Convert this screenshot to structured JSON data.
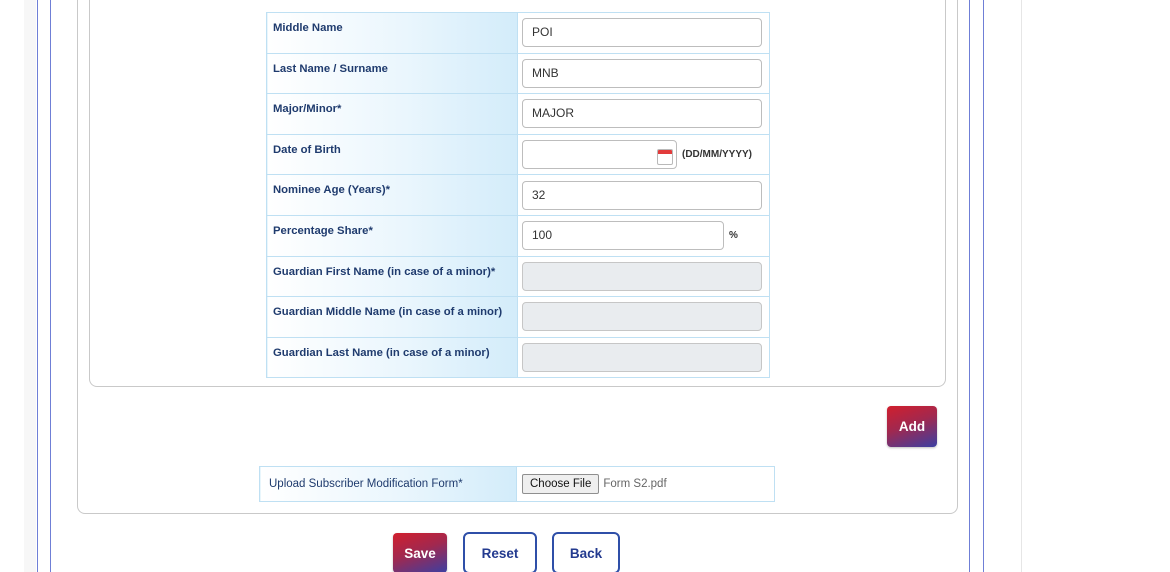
{
  "nominee_form": {
    "rows": [
      {
        "label": "Middle Name",
        "value": "POI"
      },
      {
        "label": "Last Name / Surname",
        "value": "MNB"
      },
      {
        "label": "Major/Minor*",
        "value": "MAJOR"
      },
      {
        "label": "Date of Birth",
        "value": "",
        "hint": "(DD/MM/YYYY)"
      },
      {
        "label": "Nominee Age (Years)*",
        "value": "32"
      },
      {
        "label": "Percentage Share*",
        "value": "100",
        "unit": "%"
      },
      {
        "label": "Guardian First Name (in case of a minor)*",
        "value": ""
      },
      {
        "label": "Guardian Middle Name (in case of a minor)",
        "value": ""
      },
      {
        "label": "Guardian Last Name (in case of a minor)",
        "value": ""
      }
    ]
  },
  "add_button": {
    "label": "Add"
  },
  "upload": {
    "label": "Upload Subscriber Modification Form*",
    "choose_label": "Choose File",
    "file_name": "Form S2.pdf"
  },
  "actions": {
    "save_label": "Save",
    "reset_label": "Reset",
    "back_label": "Back"
  },
  "colors": {
    "label_text": "#1f3b6e",
    "table_border": "#bfe0f3",
    "frame_blue": "#6f7fd6",
    "button_gradient_start": "#d11f2d",
    "button_gradient_end": "#3b3fa3",
    "outline_button": "#2f4fa8"
  },
  "icons": {
    "date_picker": "calendar-icon"
  }
}
